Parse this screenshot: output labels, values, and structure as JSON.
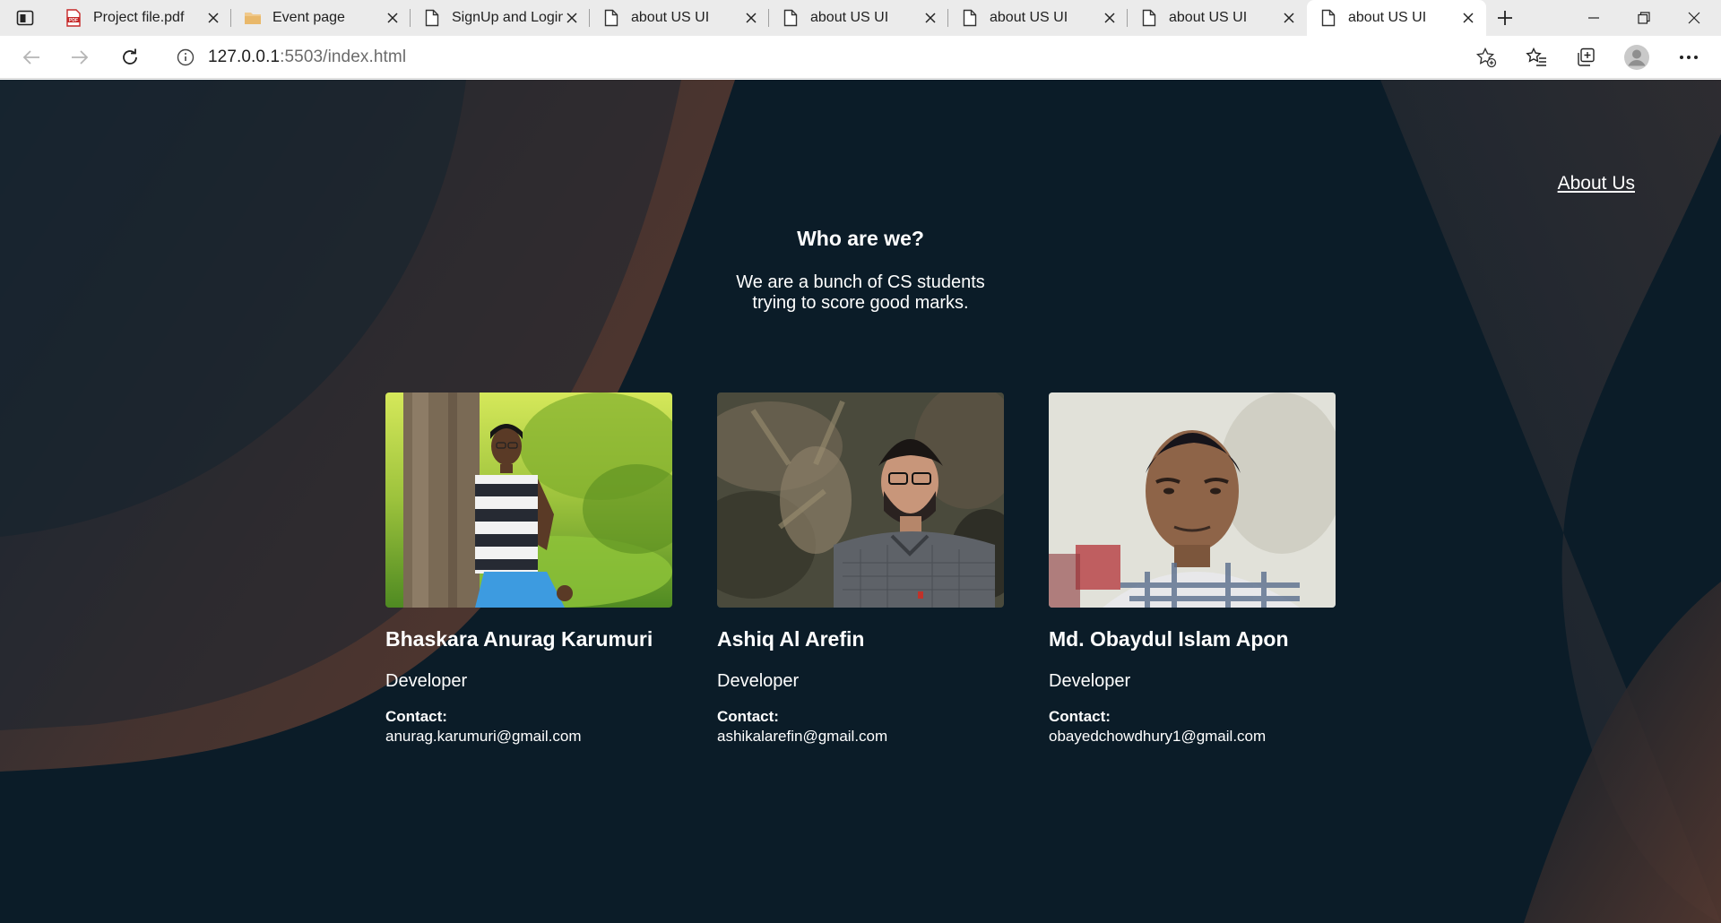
{
  "browser": {
    "tabs": [
      {
        "title": "Project file.pdf",
        "icon": "pdf-icon"
      },
      {
        "title": "Event page",
        "icon": "folder-icon"
      },
      {
        "title": "SignUp and Login",
        "icon": "page-icon"
      },
      {
        "title": "about US UI",
        "icon": "page-icon"
      },
      {
        "title": "about US UI",
        "icon": "page-icon"
      },
      {
        "title": "about US UI",
        "icon": "page-icon"
      },
      {
        "title": "about US UI",
        "icon": "page-icon"
      },
      {
        "title": "about US UI",
        "icon": "page-icon",
        "active": true
      }
    ],
    "url_host": "127.0.0.1",
    "url_rest": ":5503/index.html"
  },
  "page": {
    "nav_link": "About Us",
    "heading": "Who are we?",
    "intro": "We are a bunch of CS students trying to score good marks.",
    "team": [
      {
        "name": "Bhaskara Anurag Karumuri",
        "role": "Developer",
        "contact_label": "Contact:",
        "email": "anurag.karumuri@gmail.com"
      },
      {
        "name": "Ashiq Al Arefin",
        "role": "Developer",
        "contact_label": "Contact:",
        "email": "ashikalarefin@gmail.com"
      },
      {
        "name": "Md. Obaydul Islam Apon",
        "role": "Developer",
        "contact_label": "Contact:",
        "email": "obayedchowdhury1@gmail.com"
      }
    ]
  },
  "colors": {
    "page_background": "#0b1c28",
    "accent_brown": "#5a3a30"
  }
}
